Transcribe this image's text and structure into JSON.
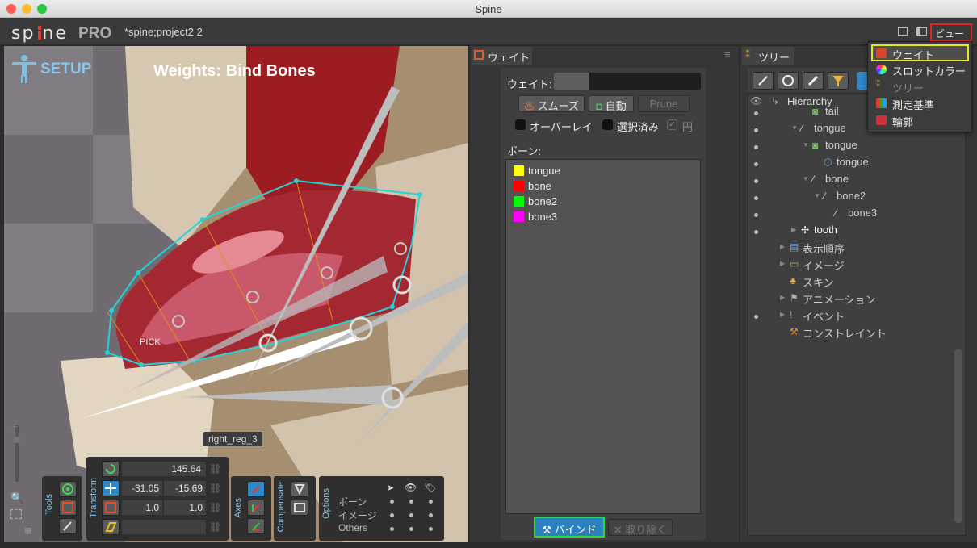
{
  "window": {
    "title": "Spine"
  },
  "app": {
    "logo": "sp ne",
    "logo_pro": "PRO",
    "project": "*spine;project2 2",
    "view_menu": "ビュー"
  },
  "viewport": {
    "mode": "SETUP",
    "heading": "Weights: Bind Bones",
    "pick_label": "PICK",
    "bone_tooltip": "right_reg_3",
    "zoom_plus": "+",
    "zoom_minus": "-"
  },
  "toolbar": {
    "tools_label": "Tools",
    "transform_label": "Transform",
    "axes_label": "Axes",
    "compensate_label": "Compensate",
    "options_label": "Options",
    "rotate": "145.64",
    "translate_x": "-31.05",
    "translate_y": "-15.69",
    "scale_x": "1.0",
    "scale_y": "1.0",
    "options_rows": [
      "ボーン",
      "イメージ",
      "Others"
    ]
  },
  "weights_panel": {
    "tab": "ウェイト",
    "weight_label": "ウェイト:",
    "smooth": "スムーズ",
    "auto": "自動",
    "prune": "Prune",
    "overlay": "オーバーレイ",
    "selected": "選択済み",
    "circle": "円",
    "bones_label": "ボーン:",
    "bones": [
      {
        "name": "tongue",
        "color": "#ffff00"
      },
      {
        "name": "bone",
        "color": "#ff0000"
      },
      {
        "name": "bone2",
        "color": "#00ff00"
      },
      {
        "name": "bone3",
        "color": "#ff00ff"
      }
    ],
    "bind": "バインド",
    "remove": "取り除く"
  },
  "tree_panel": {
    "tab": "ツリー",
    "hierarchy": "Hierarchy",
    "items": [
      {
        "label": "tail",
        "indent": 4
      },
      {
        "label": "tongue",
        "indent": 3
      },
      {
        "label": "tongue",
        "indent": 4
      },
      {
        "label": "tongue",
        "indent": 5
      },
      {
        "label": "bone",
        "indent": 4
      },
      {
        "label": "bone2",
        "indent": 5
      },
      {
        "label": "bone3",
        "indent": 6
      },
      {
        "label": "tooth",
        "indent": 3
      },
      {
        "label": "表示順序",
        "indent": 2
      },
      {
        "label": "イメージ",
        "indent": 2
      },
      {
        "label": "スキン",
        "indent": 2
      },
      {
        "label": "アニメーション",
        "indent": 2
      },
      {
        "label": "イベント",
        "indent": 2
      },
      {
        "label": "コンストレイント",
        "indent": 2
      }
    ]
  },
  "view_menu": {
    "items": [
      {
        "label": "ウェイト",
        "color": "#d8452e"
      },
      {
        "label": "スロットカラー",
        "color": "#e8b800"
      },
      {
        "label": "ツリー",
        "color": "#c9a03a"
      },
      {
        "label": "測定基準",
        "color": "#4a90d9"
      },
      {
        "label": "輪郭",
        "color": "#d0303a"
      }
    ]
  }
}
